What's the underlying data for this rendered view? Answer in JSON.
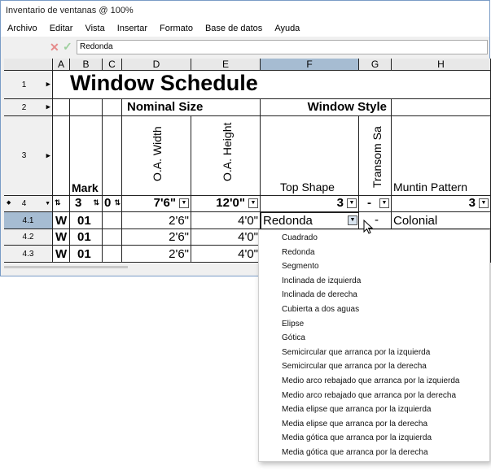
{
  "window": {
    "title": "Inventario de ventanas @ 100%"
  },
  "menu": [
    "Archivo",
    "Editar",
    "Vista",
    "Insertar",
    "Formato",
    "Base de datos",
    "Ayuda"
  ],
  "formula": {
    "value": "Redonda"
  },
  "columns": [
    "A",
    "B",
    "C",
    "D",
    "E",
    "F",
    "G",
    "H"
  ],
  "rows": {
    "r1": "1",
    "r2": "2",
    "r3": "3",
    "r4": "4",
    "r41": "4.1",
    "r42": "4.2",
    "r43": "4.3"
  },
  "schedule": {
    "title": "Window Schedule",
    "nominal_size": "Nominal Size",
    "window_style": "Window Style",
    "headers": {
      "mark": "Mark",
      "oa_width": "O.A. Width",
      "oa_height": "O.A. Height",
      "top_shape": "Top Shape",
      "transom": "Transom Sa",
      "muntin": "Muntin Pattern"
    },
    "row4": {
      "mark": "3",
      "c": "0",
      "width": "7'6\"",
      "height": "12'0\"",
      "top_shape": "3",
      "transom": "-",
      "muntin": "3"
    },
    "data_rows": [
      {
        "a": "W",
        "b": "01",
        "width": "2'6\"",
        "height": "4'0\"",
        "top_shape": "Redonda",
        "transom": "-",
        "muntin": "Colonial"
      },
      {
        "a": "W",
        "b": "01",
        "width": "2'6\"",
        "height": "4'0\""
      },
      {
        "a": "W",
        "b": "01",
        "width": "2'6\"",
        "height": "4'0\""
      }
    ]
  },
  "dropdown_options": [
    "Cuadrado",
    "Redonda",
    "Segmento",
    "Inclinada de izquierda",
    "Inclinada de derecha",
    "Cubierta a dos aguas",
    "Elipse",
    "Gótica",
    "Semicircular que arranca por la izquierda",
    "Semicircular que arranca por la derecha",
    "Medio arco rebajado que arranca por la izquierda",
    "Medio arco rebajado que arranca por la derecha",
    "Media elipse que arranca por la izquierda",
    "Media elipse que arranca por la derecha",
    "Media gótica que arranca por la izquierda",
    "Media gótica que arranca por la derecha"
  ],
  "colors": {
    "selected_header": "#a6bcd2",
    "border": "#7a9cc6",
    "grid": "#222222"
  }
}
